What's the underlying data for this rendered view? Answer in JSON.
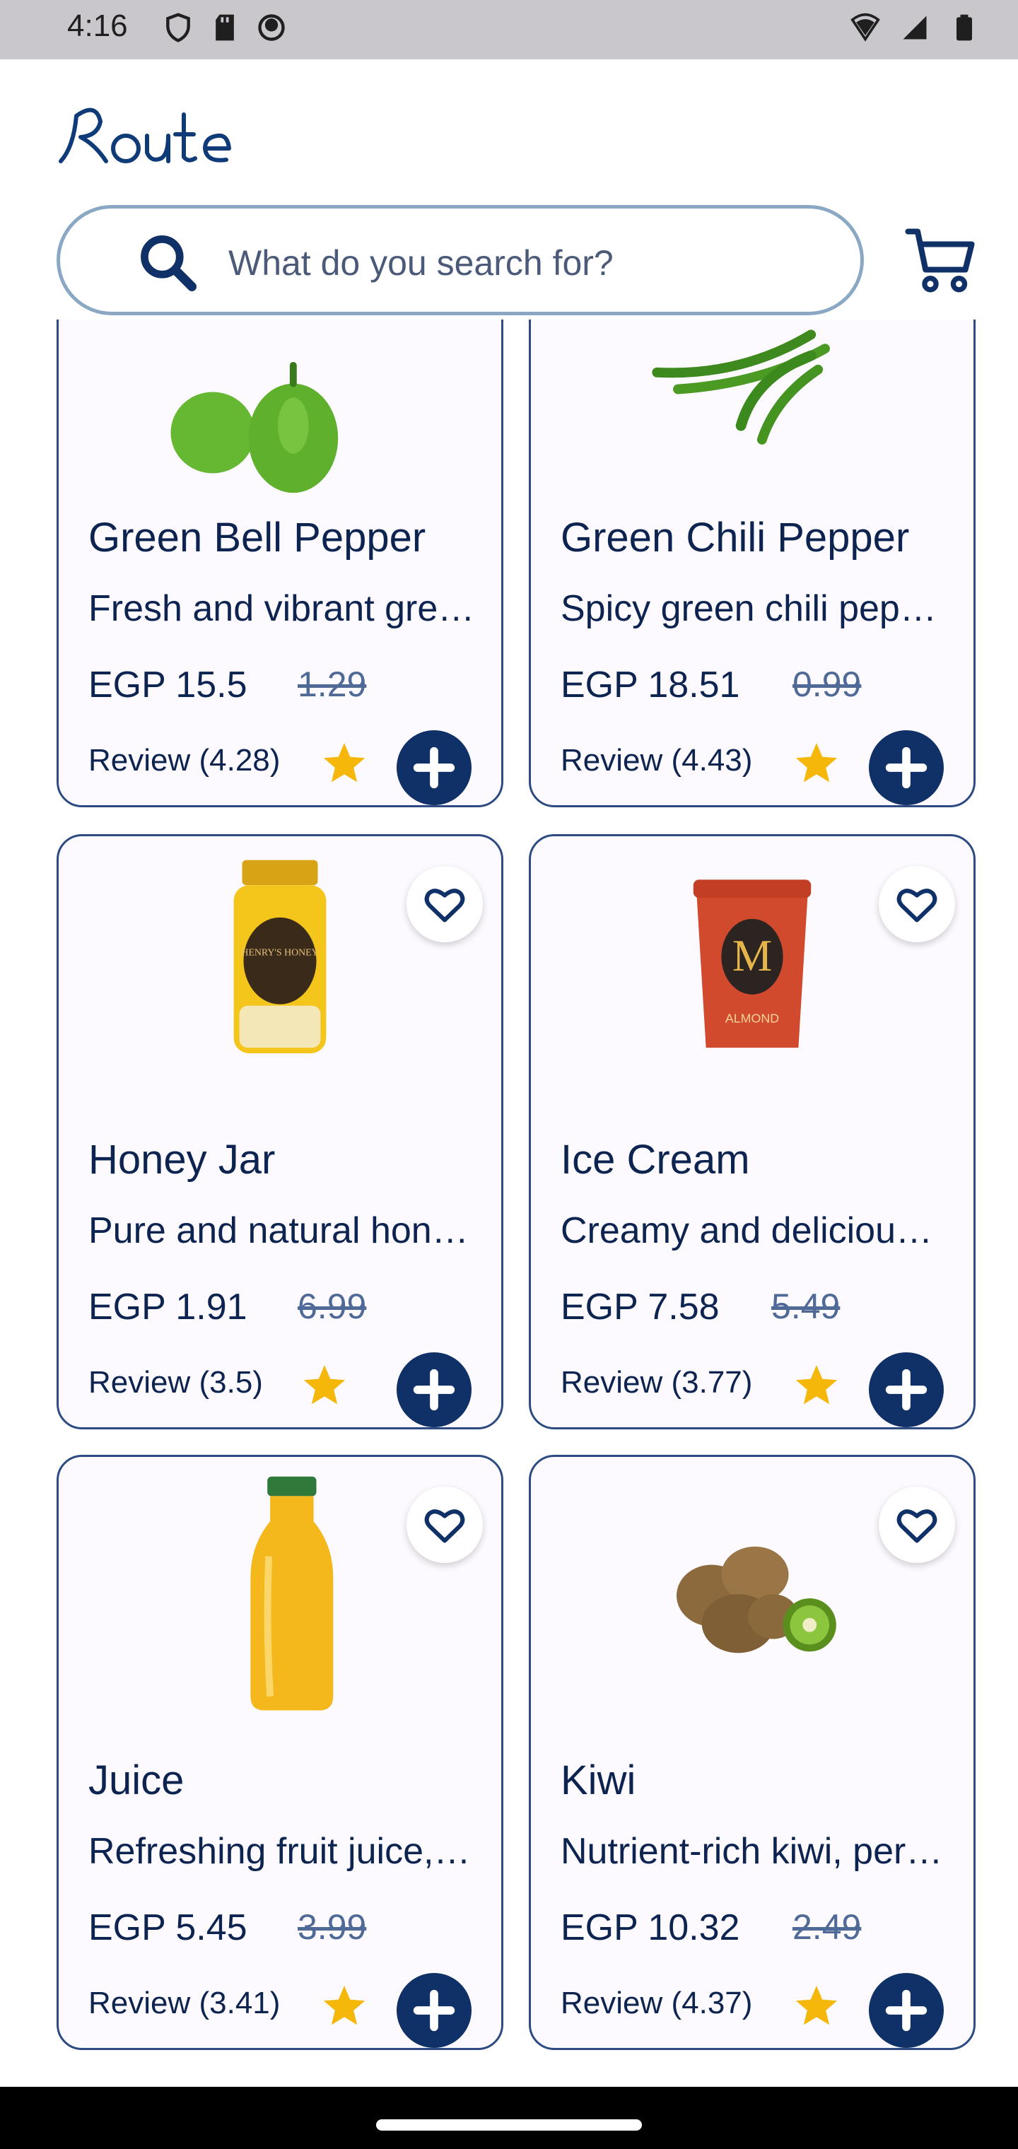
{
  "status_bar": {
    "time": "4:16"
  },
  "search": {
    "placeholder": "What do you search for?"
  },
  "products": [
    {
      "title": "Green Bell Pepper",
      "desc": "Fresh and vibrant gre…",
      "price": "EGP 15.5",
      "old_price": "1.29",
      "review": "Review (4.28)",
      "icon": "green-bell-pepper-image"
    },
    {
      "title": "Green Chili Pepper",
      "desc": "Spicy green chili pep…",
      "price": "EGP 18.51",
      "old_price": "0.99",
      "review": "Review (4.43)",
      "icon": "green-chili-pepper-image"
    },
    {
      "title": "Honey Jar",
      "desc": "Pure and natural hon…",
      "price": "EGP 1.91",
      "old_price": "6.99",
      "review": "Review (3.5)",
      "icon": "honey-jar-image",
      "jar_label": "HENRY'S HONEY"
    },
    {
      "title": "Ice Cream",
      "desc": "Creamy and deliciou…",
      "price": "EGP 7.58",
      "old_price": "5.49",
      "review": "Review (3.77)",
      "icon": "ice-cream-tub-image",
      "tub_label": "ALMOND"
    },
    {
      "title": "Juice",
      "desc": "Refreshing fruit juice,…",
      "price": "EGP 5.45",
      "old_price": "3.99",
      "review": "Review (3.41)",
      "icon": "juice-bottle-image"
    },
    {
      "title": "Kiwi",
      "desc": "Nutrient-rich kiwi, per…",
      "price": "EGP 10.32",
      "old_price": "2.49",
      "review": "Review (4.37)",
      "icon": "kiwi-image"
    }
  ],
  "colors": {
    "primary": "#0f3167",
    "card_border": "#2d4b82",
    "star": "#f5b70a",
    "search_border": "#8aa8c4"
  }
}
